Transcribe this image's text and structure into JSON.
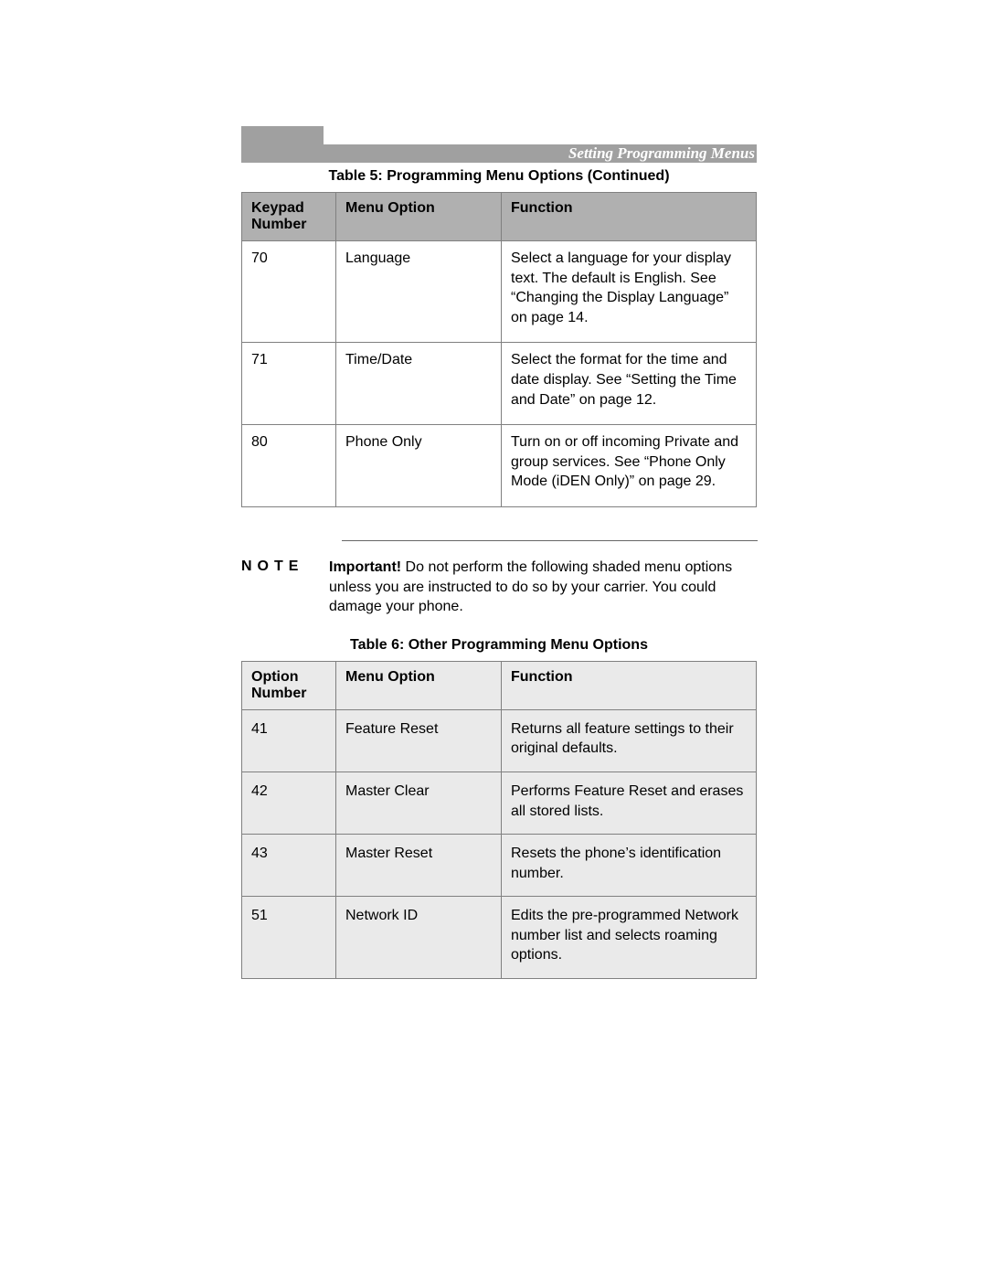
{
  "header": {
    "section_title": "Setting Programming Menus"
  },
  "table5": {
    "title": "Table 5: Programming Menu Options  (Continued)",
    "headers": [
      "Keypad Number",
      "Menu Option",
      "Function"
    ],
    "rows": [
      {
        "num": "70",
        "option": "Language",
        "func": "Select a language for your display text. The default is English. See “Changing the Display Language” on page 14."
      },
      {
        "num": "71",
        "option": "Time/Date",
        "func": "Select the format for the time and date display. See “Setting the Time and Date” on page 12."
      },
      {
        "num": "80",
        "option": "Phone Only",
        "func": "Turn on or off incoming Private and group services. See “Phone Only Mode (iDEN Only)” on page 29."
      }
    ]
  },
  "note": {
    "label": "NOTE",
    "bold": "Important!",
    "text": " Do not perform the following shaded menu options unless you are instructed to do so by your carrier. You could damage your phone."
  },
  "table6": {
    "title": "Table 6: Other Programming Menu Options",
    "headers": [
      "Option Number",
      "Menu Option",
      "Function"
    ],
    "rows": [
      {
        "num": "41",
        "option": "Feature Reset",
        "func": "Returns all feature settings to their original defaults."
      },
      {
        "num": "42",
        "option": "Master Clear",
        "func": "Performs Feature Reset and erases all stored lists."
      },
      {
        "num": "43",
        "option": "Master Reset",
        "func": "Resets the phone’s identification number."
      },
      {
        "num": "51",
        "option": "Network ID",
        "func": "Edits the pre-programmed Network number list and selects roaming options."
      }
    ]
  }
}
